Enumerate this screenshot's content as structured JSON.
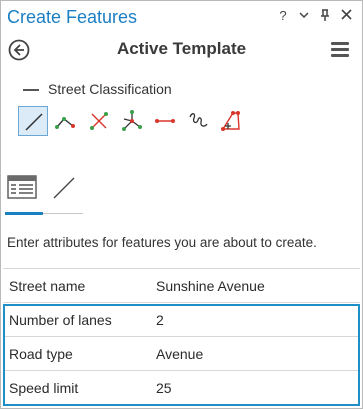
{
  "pane": {
    "title": "Create Features",
    "controls": {
      "help": "?",
      "dropdown": "⌄",
      "pin": "📌",
      "close": "✕"
    }
  },
  "header": {
    "title": "Active Template",
    "back_icon": "back-arrow-icon",
    "menu_icon": "hamburger-menu-icon"
  },
  "template": {
    "name": "Street Classification",
    "tools": [
      {
        "icon": "line-tool-icon",
        "selected": true
      },
      {
        "icon": "right-angle-line-icon",
        "selected": false
      },
      {
        "icon": "midpoint-line-icon",
        "selected": false
      },
      {
        "icon": "direction-distance-icon",
        "selected": false
      },
      {
        "icon": "distance-distance-icon",
        "selected": false
      },
      {
        "icon": "freehand-line-icon",
        "selected": false
      },
      {
        "icon": "trace-icon",
        "selected": false
      }
    ]
  },
  "tabs": [
    {
      "icon": "attributes-table-icon",
      "selected": true
    },
    {
      "icon": "geometry-line-icon",
      "selected": false
    }
  ],
  "hint": "Enter attributes for features you are about to create.",
  "attributes": [
    {
      "name": "Street name",
      "value": "Sunshine Avenue"
    },
    {
      "name": "Number of lanes",
      "value": "2"
    },
    {
      "name": "Road type",
      "value": "Avenue"
    },
    {
      "name": "Speed limit",
      "value": "25"
    }
  ],
  "colors": {
    "accent": "#1b7fc4",
    "highlight": "#1f8fc8",
    "vertex_green": "#3aa14a",
    "vertex_red": "#d9362b"
  }
}
